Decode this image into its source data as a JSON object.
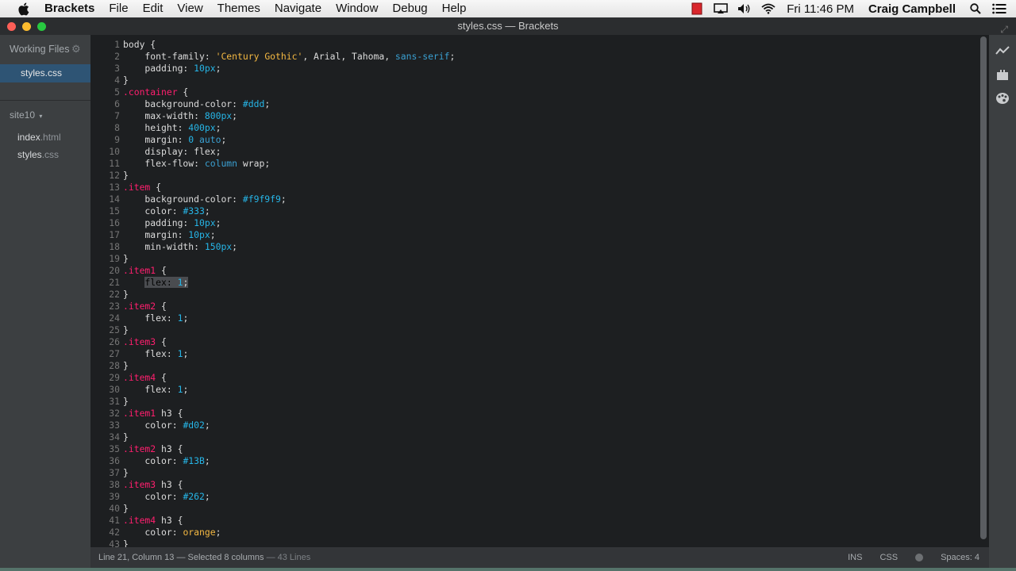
{
  "menubar": {
    "app_name": "Brackets",
    "items": [
      "File",
      "Edit",
      "View",
      "Themes",
      "Navigate",
      "Window",
      "Debug",
      "Help"
    ],
    "clock": "Fri 11:46 PM",
    "user": "Craig Campbell"
  },
  "window": {
    "title": "styles.css — Brackets"
  },
  "sidebar": {
    "working_files_label": "Working Files",
    "working_files": [
      {
        "name": "styles.css"
      }
    ],
    "project_name": "site10",
    "tree": [
      {
        "base": "index",
        "ext": ".html"
      },
      {
        "base": "styles",
        "ext": ".css"
      }
    ]
  },
  "editor": {
    "lines": [
      [
        [
          "tx",
          "body {"
        ]
      ],
      [
        [
          "tx",
          "    font-family: "
        ],
        [
          "str",
          "'Century Gothic'"
        ],
        [
          "tx",
          ", Arial, Tahoma, "
        ],
        [
          "kw",
          "sans-serif"
        ],
        [
          "tx",
          ";"
        ]
      ],
      [
        [
          "tx",
          "    padding: "
        ],
        [
          "num",
          "10px"
        ],
        [
          "tx",
          ";"
        ]
      ],
      [
        [
          "tx",
          "}"
        ]
      ],
      [
        [
          "sel",
          ".container"
        ],
        [
          "tx",
          " {"
        ]
      ],
      [
        [
          "tx",
          "    background-color: "
        ],
        [
          "num",
          "#ddd"
        ],
        [
          "tx",
          ";"
        ]
      ],
      [
        [
          "tx",
          "    max-width: "
        ],
        [
          "num",
          "800px"
        ],
        [
          "tx",
          ";"
        ]
      ],
      [
        [
          "tx",
          "    height: "
        ],
        [
          "num",
          "400px"
        ],
        [
          "tx",
          ";"
        ]
      ],
      [
        [
          "tx",
          "    margin: "
        ],
        [
          "num",
          "0"
        ],
        [
          "tx",
          " "
        ],
        [
          "kw",
          "auto"
        ],
        [
          "tx",
          ";"
        ]
      ],
      [
        [
          "tx",
          "    display: flex;"
        ]
      ],
      [
        [
          "tx",
          "    flex-flow: "
        ],
        [
          "kw",
          "column"
        ],
        [
          "tx",
          " wrap;"
        ]
      ],
      [
        [
          "tx",
          "}"
        ]
      ],
      [
        [
          "sel",
          ".item"
        ],
        [
          "tx",
          " {"
        ]
      ],
      [
        [
          "tx",
          "    background-color: "
        ],
        [
          "num",
          "#f9f9f9"
        ],
        [
          "tx",
          ";"
        ]
      ],
      [
        [
          "tx",
          "    color: "
        ],
        [
          "num",
          "#333"
        ],
        [
          "tx",
          ";"
        ]
      ],
      [
        [
          "tx",
          "    padding: "
        ],
        [
          "num",
          "10px"
        ],
        [
          "tx",
          ";"
        ]
      ],
      [
        [
          "tx",
          "    margin: "
        ],
        [
          "num",
          "10px"
        ],
        [
          "tx",
          ";"
        ]
      ],
      [
        [
          "tx",
          "    min-width: "
        ],
        [
          "num",
          "150px"
        ],
        [
          "tx",
          ";"
        ]
      ],
      [
        [
          "tx",
          "}"
        ]
      ],
      [
        [
          "sel",
          ".item1"
        ],
        [
          "tx",
          " {"
        ]
      ],
      [
        [
          "tx",
          "    "
        ],
        [
          "sel-hl",
          "flex: "
        ],
        [
          "num sel-hl",
          "1"
        ],
        [
          "tx sel-hl",
          ";"
        ]
      ],
      [
        [
          "tx",
          "}"
        ]
      ],
      [
        [
          "sel",
          ".item2"
        ],
        [
          "tx",
          " {"
        ]
      ],
      [
        [
          "tx",
          "    flex: "
        ],
        [
          "num",
          "1"
        ],
        [
          "tx",
          ";"
        ]
      ],
      [
        [
          "tx",
          "}"
        ]
      ],
      [
        [
          "sel",
          ".item3"
        ],
        [
          "tx",
          " {"
        ]
      ],
      [
        [
          "tx",
          "    flex: "
        ],
        [
          "num",
          "1"
        ],
        [
          "tx",
          ";"
        ]
      ],
      [
        [
          "tx",
          "}"
        ]
      ],
      [
        [
          "sel",
          ".item4"
        ],
        [
          "tx",
          " {"
        ]
      ],
      [
        [
          "tx",
          "    flex: "
        ],
        [
          "num",
          "1"
        ],
        [
          "tx",
          ";"
        ]
      ],
      [
        [
          "tx",
          "}"
        ]
      ],
      [
        [
          "sel",
          ".item1"
        ],
        [
          "tx",
          " h3 {"
        ]
      ],
      [
        [
          "tx",
          "    color: "
        ],
        [
          "num",
          "#d02"
        ],
        [
          "tx",
          ";"
        ]
      ],
      [
        [
          "tx",
          "}"
        ]
      ],
      [
        [
          "sel",
          ".item2"
        ],
        [
          "tx",
          " h3 {"
        ]
      ],
      [
        [
          "tx",
          "    color: "
        ],
        [
          "num",
          "#13B"
        ],
        [
          "tx",
          ";"
        ]
      ],
      [
        [
          "tx",
          "}"
        ]
      ],
      [
        [
          "sel",
          ".item3"
        ],
        [
          "tx",
          " h3 {"
        ]
      ],
      [
        [
          "tx",
          "    color: "
        ],
        [
          "num",
          "#262"
        ],
        [
          "tx",
          ";"
        ]
      ],
      [
        [
          "tx",
          "}"
        ]
      ],
      [
        [
          "sel",
          ".item4"
        ],
        [
          "tx",
          " h3 {"
        ]
      ],
      [
        [
          "tx",
          "    color: "
        ],
        [
          "str",
          "orange"
        ],
        [
          "tx",
          ";"
        ]
      ],
      [
        [
          "tx",
          "}"
        ]
      ]
    ]
  },
  "status": {
    "cursor": "Line 21, Column 13 — Selected 8 columns",
    "line_count": "— 43 Lines",
    "mode": "INS",
    "language": "CSS",
    "indent": "Spaces: 4"
  },
  "colors": {
    "accent_selection": "#2e5474",
    "selector": "#ff1f6e",
    "number": "#26b6e8",
    "string": "#f5b942"
  }
}
